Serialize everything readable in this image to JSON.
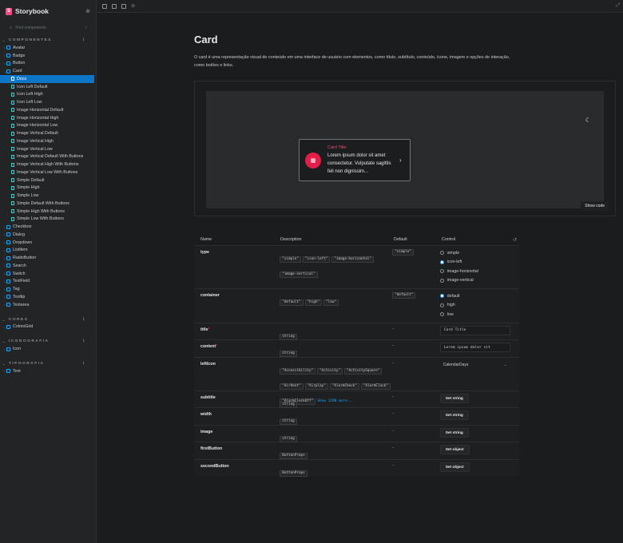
{
  "brand": {
    "name": "Storybook"
  },
  "search": {
    "placeholder": "Find components",
    "shortcut": "/"
  },
  "groups": [
    {
      "title": "COMPONENTES",
      "items": [
        {
          "label": "Avatar",
          "children": []
        },
        {
          "label": "Badge",
          "children": []
        },
        {
          "label": "Button",
          "children": []
        },
        {
          "label": "Card",
          "expanded": true,
          "children": [
            {
              "label": "Docs",
              "kind": "doc",
              "selected": true
            },
            {
              "label": "Icon Left Default"
            },
            {
              "label": "Icon Left High"
            },
            {
              "label": "Icon Left Low"
            },
            {
              "label": "Image Horizontal Default"
            },
            {
              "label": "Image Horizontal High"
            },
            {
              "label": "Image Horizontal Low"
            },
            {
              "label": "Image Vertical Default"
            },
            {
              "label": "Image Vertical High"
            },
            {
              "label": "Image Vertical Low"
            },
            {
              "label": "Image Vertical Default With Buttons"
            },
            {
              "label": "Image Vertical High With Buttons"
            },
            {
              "label": "Image Vertical Low With Buttons"
            },
            {
              "label": "Simple Default"
            },
            {
              "label": "Simple High"
            },
            {
              "label": "Simple Low"
            },
            {
              "label": "Simple Default With Buttons"
            },
            {
              "label": "Simple High With Buttons"
            },
            {
              "label": "Simple Low With Buttons"
            }
          ]
        },
        {
          "label": "Checkbox",
          "children": []
        },
        {
          "label": "Dialog",
          "children": []
        },
        {
          "label": "Dropdown",
          "children": []
        },
        {
          "label": "ListItem",
          "children": []
        },
        {
          "label": "RadioButton",
          "children": []
        },
        {
          "label": "Search",
          "children": []
        },
        {
          "label": "Switch",
          "children": []
        },
        {
          "label": "TextField",
          "children": []
        },
        {
          "label": "Tag",
          "children": []
        },
        {
          "label": "Tooltip",
          "children": []
        },
        {
          "label": "Textarea",
          "children": []
        }
      ]
    },
    {
      "title": "CORES",
      "items": [
        {
          "label": "ColorsGrid",
          "children": []
        }
      ]
    },
    {
      "title": "ICONOGRAFIA",
      "items": [
        {
          "label": "Icon",
          "children": []
        }
      ]
    },
    {
      "title": "TIPOGRAFIA",
      "items": [
        {
          "label": "Text",
          "children": []
        }
      ]
    }
  ],
  "doc": {
    "title": "Card",
    "description": "O card é uma representação visual de conteúdo em uma interface de usuário com elementos, como título, subtítulo, conteúdo, ícone, imagem e opções de interação, como botões e links.",
    "show_code": "Show code"
  },
  "card_preview": {
    "title": "Card Title",
    "text": "Lorem ipsum dolor sit amet consectetur. Vulputate sagittis feli non dignissim..."
  },
  "args_table": {
    "headers": {
      "name": "Name",
      "description": "Description",
      "default": "Default",
      "control": "Control"
    },
    "rows": [
      {
        "name": "type",
        "types": [
          "\"simple\"",
          "\"icon-left\"",
          "\"image-horizontal\"",
          "\"image-vertical\""
        ],
        "default": "\"simple\"",
        "control": "radio",
        "options": [
          "simple",
          "icon-left",
          "image-horizontal",
          "image-vertical"
        ],
        "selected": 1
      },
      {
        "name": "container",
        "types": [
          "\"default\"",
          "\"high\"",
          "\"low\""
        ],
        "default": "\"default\"",
        "control": "radio",
        "options": [
          "default",
          "high",
          "low"
        ],
        "selected": 0
      },
      {
        "name": "title",
        "required": true,
        "types": [
          "string"
        ],
        "default": "-",
        "control": "text",
        "value": "Card Title"
      },
      {
        "name": "content",
        "required": true,
        "types": [
          "string"
        ],
        "default": "-",
        "control": "text",
        "value": "Lorem ipsum dolor sit"
      },
      {
        "name": "leftIcon",
        "types": [
          "\"Accessibility\"",
          "\"Activity\"",
          "\"ActivitySquare\"",
          "\"AirVent\"",
          "\"Airplay\"",
          "\"AlarmCheck\"",
          "\"AlarmClock\"",
          "\"AlarmClockOff\""
        ],
        "more": "Show 1298 more...",
        "default": "-",
        "control": "select",
        "value": "CalendarDays"
      },
      {
        "name": "subtitle",
        "types": [
          "string"
        ],
        "default": "-",
        "control": "button",
        "value": "Set string"
      },
      {
        "name": "width",
        "types": [
          "string"
        ],
        "default": "-",
        "control": "button",
        "value": "Set string"
      },
      {
        "name": "image",
        "types": [
          "string"
        ],
        "default": "-",
        "control": "button",
        "value": "Set string"
      },
      {
        "name": "firstButton",
        "types": [
          "ButtonProps"
        ],
        "default": "-",
        "control": "button",
        "value": "Set object"
      },
      {
        "name": "secondButton",
        "types": [
          "ButtonProps"
        ],
        "default": "-",
        "control": "button",
        "value": "Set object"
      }
    ]
  },
  "colors": {
    "accent": "#0d76c6",
    "brand": "#ff4785",
    "card_icon": "#e11d48"
  }
}
